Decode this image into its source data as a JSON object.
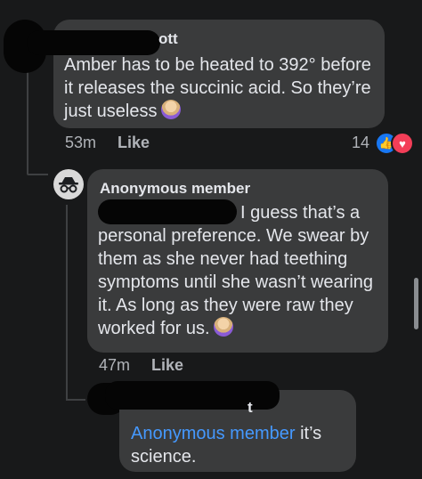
{
  "comment1": {
    "author_visible": "ott",
    "text": "Amber has to be heated to 392° before it releases the succinic acid. So they’re just useless",
    "time": "53m",
    "like_label": "Like",
    "reaction_count": "14"
  },
  "comment2": {
    "author": "Anonymous member",
    "text": "I guess that’s a personal preference. We swear by them as she never had teething symptoms until she wasn’t wearing it. As long as they were raw they worked for us.",
    "time": "47m",
    "like_label": "Like"
  },
  "comment3": {
    "author_visible": "t",
    "mention": "Anonymous member",
    "text": " it’s science."
  },
  "colors": {
    "background": "#18191a",
    "bubble": "#3a3b3c",
    "mention": "#4599ff",
    "like_blue": "#1877f2",
    "love_red": "#f33e58"
  }
}
